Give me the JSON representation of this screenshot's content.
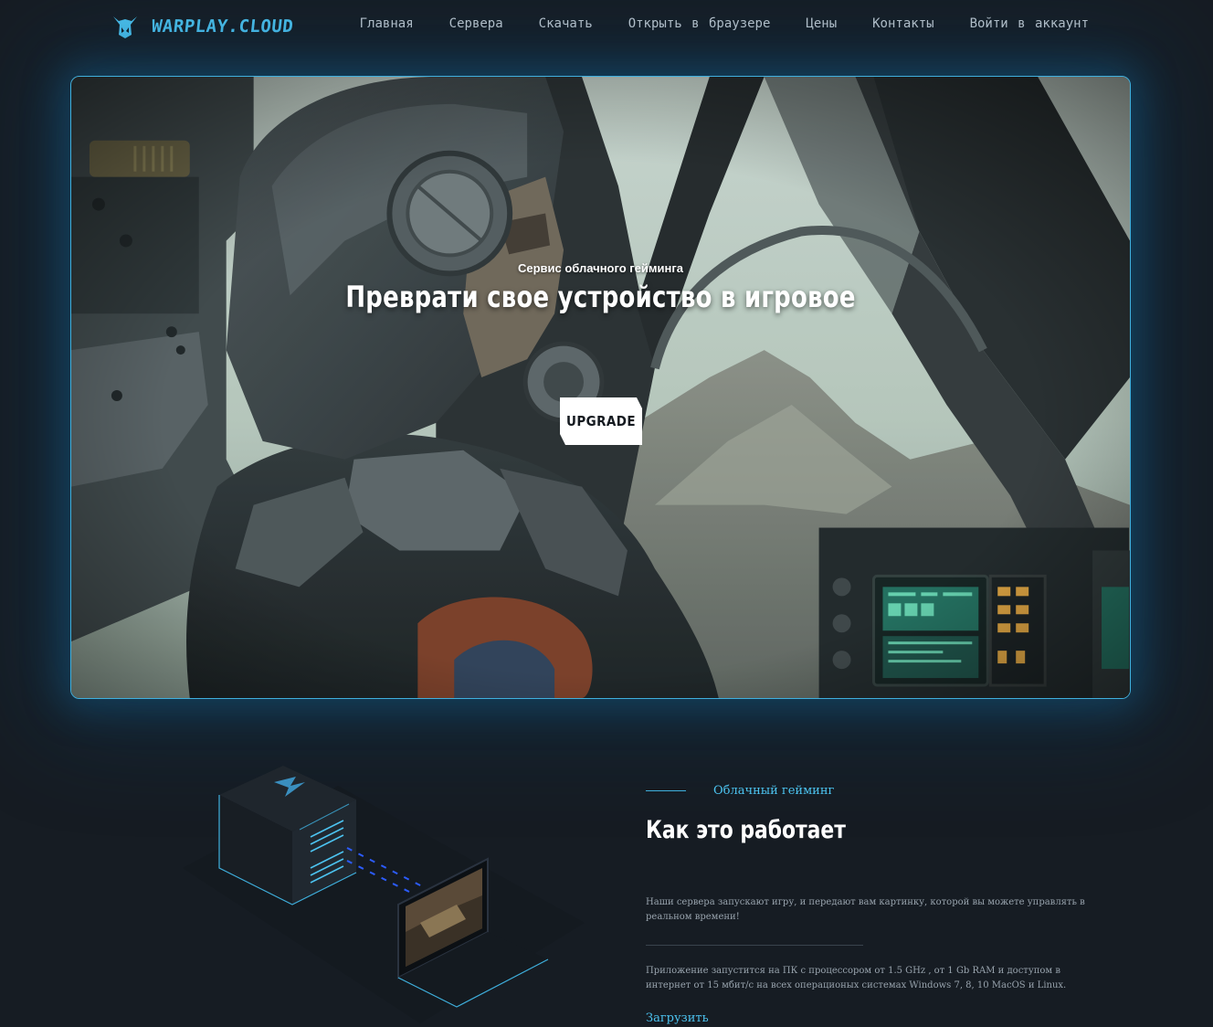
{
  "brand": {
    "logo_text": "WARPLAY.CLOUD",
    "accent_color": "#4cc3f0"
  },
  "nav": {
    "items": [
      {
        "label": "Главная"
      },
      {
        "label": "Сервера"
      },
      {
        "label": "Скачать"
      },
      {
        "label": "Открыть в браузере"
      },
      {
        "label": "Цены"
      },
      {
        "label": "Контакты"
      },
      {
        "label": "Войти в аккаунт"
      }
    ]
  },
  "hero": {
    "subtitle": "Сервис облачного гейминга",
    "title": "Преврати свое устройство в игровое",
    "cta_label": "UPGRADE"
  },
  "how_it_works": {
    "eyebrow": "Облачный гейминг",
    "title": "Как это работает",
    "paragraph_1": "Наши сервера запускают игру, и передают вам картинку, которой вы можете управлять в реальном времени!",
    "paragraph_2": "Приложение запустится на ПК с процессором от 1.5 GHz , от 1 Gb RAM и доступом в интернет от 15 мбит/с на всех операционых системах Windows 7, 8, 10 MacOS и Linux.",
    "download_label": "Загрузить"
  },
  "colors": {
    "background": "#161c23",
    "hero_border": "#3fb0de",
    "cta_bg": "#ffffff"
  }
}
